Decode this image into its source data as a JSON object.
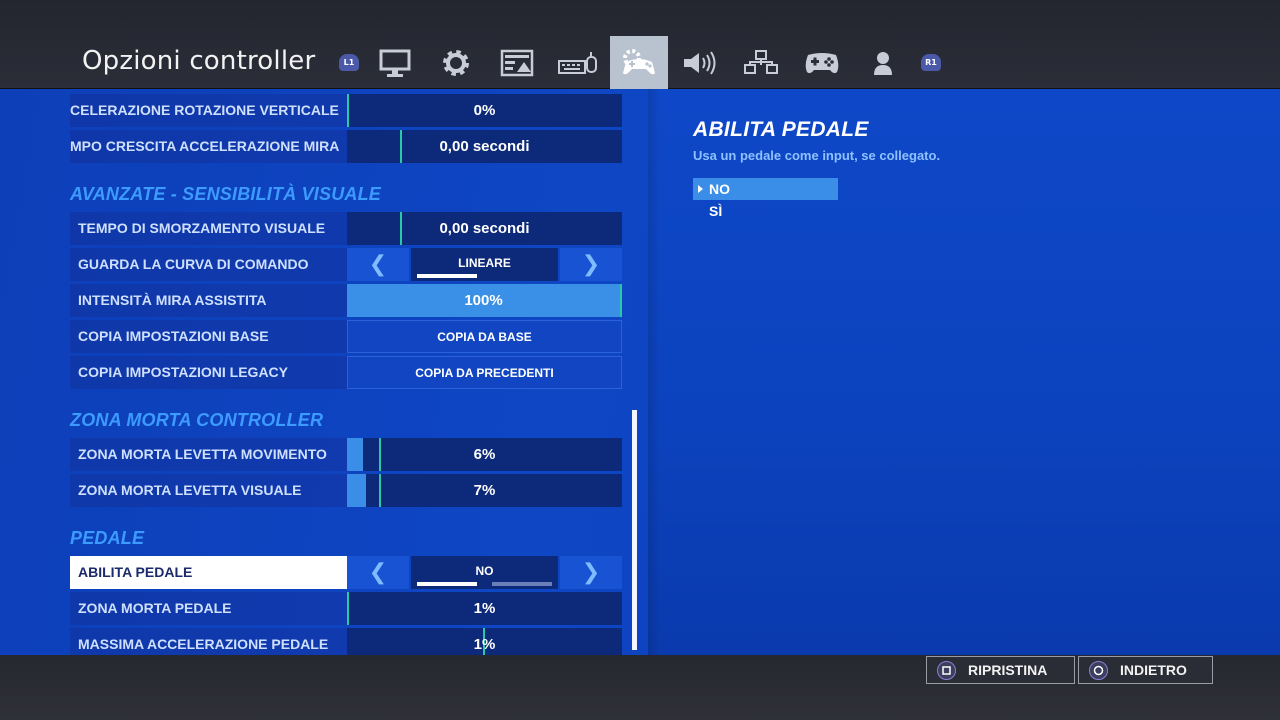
{
  "header": {
    "title": "Opzioni controller",
    "l1": "L1",
    "r1": "R1",
    "tabs": [
      {
        "icon": "monitor-icon"
      },
      {
        "icon": "gear-icon"
      },
      {
        "icon": "game-ui-icon"
      },
      {
        "icon": "keyboard-mouse-icon"
      },
      {
        "icon": "controller-settings-icon",
        "active": true
      },
      {
        "icon": "audio-icon"
      },
      {
        "icon": "accessibility-icon"
      },
      {
        "icon": "gamepad-icon"
      },
      {
        "icon": "account-icon"
      }
    ]
  },
  "settings": {
    "row_accel_vert": {
      "label": "CELERAZIONE ROTAZIONE VERTICALE",
      "value": "0%"
    },
    "row_ramp_time": {
      "label": "MPO CRESCITA ACCELERAZIONE MIRA",
      "value": "0,00 secondi"
    },
    "section_advanced": "AVANZATE - SENSIBILITÀ VISUALE",
    "row_damping": {
      "label": "TEMPO DI SMORZAMENTO VISUALE",
      "value": "0,00 secondi"
    },
    "row_curve": {
      "label": "GUARDA LA CURVA DI COMANDO",
      "value": "LINEARE"
    },
    "row_aim_assist": {
      "label": "INTENSITÀ MIRA ASSISTITA",
      "value": "100%"
    },
    "row_copy_base": {
      "label": "COPIA IMPOSTAZIONI BASE",
      "value": "COPIA DA BASE"
    },
    "row_copy_legacy": {
      "label": "COPIA IMPOSTAZIONI LEGACY",
      "value": "COPIA DA PRECEDENTI"
    },
    "section_deadzone": "ZONA MORTA CONTROLLER",
    "row_dz_move": {
      "label": "ZONA MORTA LEVETTA MOVIMENTO",
      "value": "6%",
      "level": 6
    },
    "row_dz_look": {
      "label": "ZONA MORTA LEVETTA VISUALE",
      "value": "7%",
      "level": 7
    },
    "section_pedal": "PEDALE",
    "row_pedal_enable": {
      "label": "ABILITA PEDALE",
      "value": "NO"
    },
    "row_pedal_dz": {
      "label": "ZONA MORTA PEDALE",
      "value": "1%"
    },
    "row_pedal_max": {
      "label": "MASSIMA ACCELERAZIONE PEDALE",
      "value": "1%"
    }
  },
  "detail": {
    "title": "ABILITA PEDALE",
    "description": "Usa un pedale come input, se collegato.",
    "options": [
      "NO",
      "SÌ"
    ],
    "selected": "NO"
  },
  "footer": {
    "reset_label": "RIPRISTINA",
    "back_label": "INDIETRO"
  },
  "colors": {
    "accent": "#3a8ee8",
    "section": "#3d9bff",
    "marker": "#29c9a8",
    "active_tab": "#b9c2cf"
  }
}
